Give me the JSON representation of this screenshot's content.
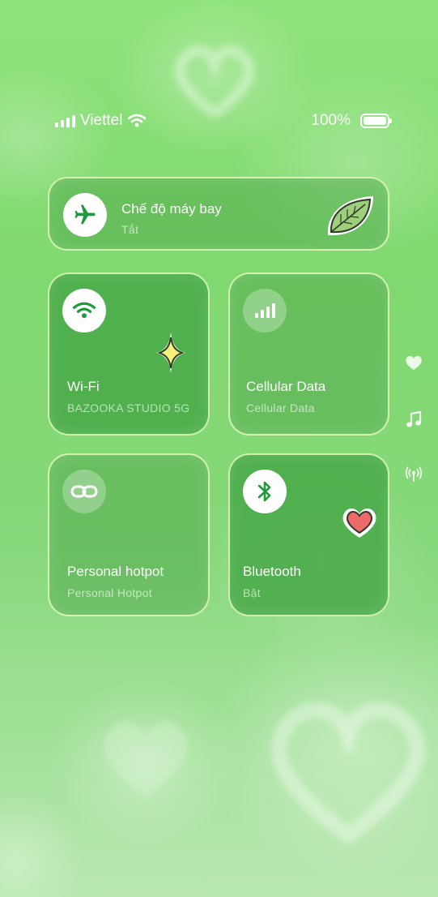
{
  "status_bar": {
    "carrier": "Viettel",
    "battery": "100%"
  },
  "airplane": {
    "title": "Chế độ máy bay",
    "state": "Tắt",
    "icon": "airplane-icon"
  },
  "tiles": {
    "wifi": {
      "title": "Wi-Fi",
      "subtitle": "BAZOOKA STUDIO 5G",
      "icon": "wifi-icon"
    },
    "cellular": {
      "title": "Cellular Data",
      "subtitle": "Cellular Data",
      "icon": "cellular-signal-icon"
    },
    "hotspot": {
      "title": "Personal hotpot",
      "subtitle": "Personal Hotpot",
      "icon": "link-icon"
    },
    "bluetooth": {
      "title": "Bluetooth",
      "subtitle": "Bật",
      "icon": "bluetooth-icon"
    }
  },
  "side_icons": [
    "heart-icon",
    "music-note-icon",
    "broadcast-icon"
  ],
  "colors": {
    "accent_green": "#1f9a3a",
    "card_border": "#e6fabe",
    "background": "#86d87a"
  }
}
